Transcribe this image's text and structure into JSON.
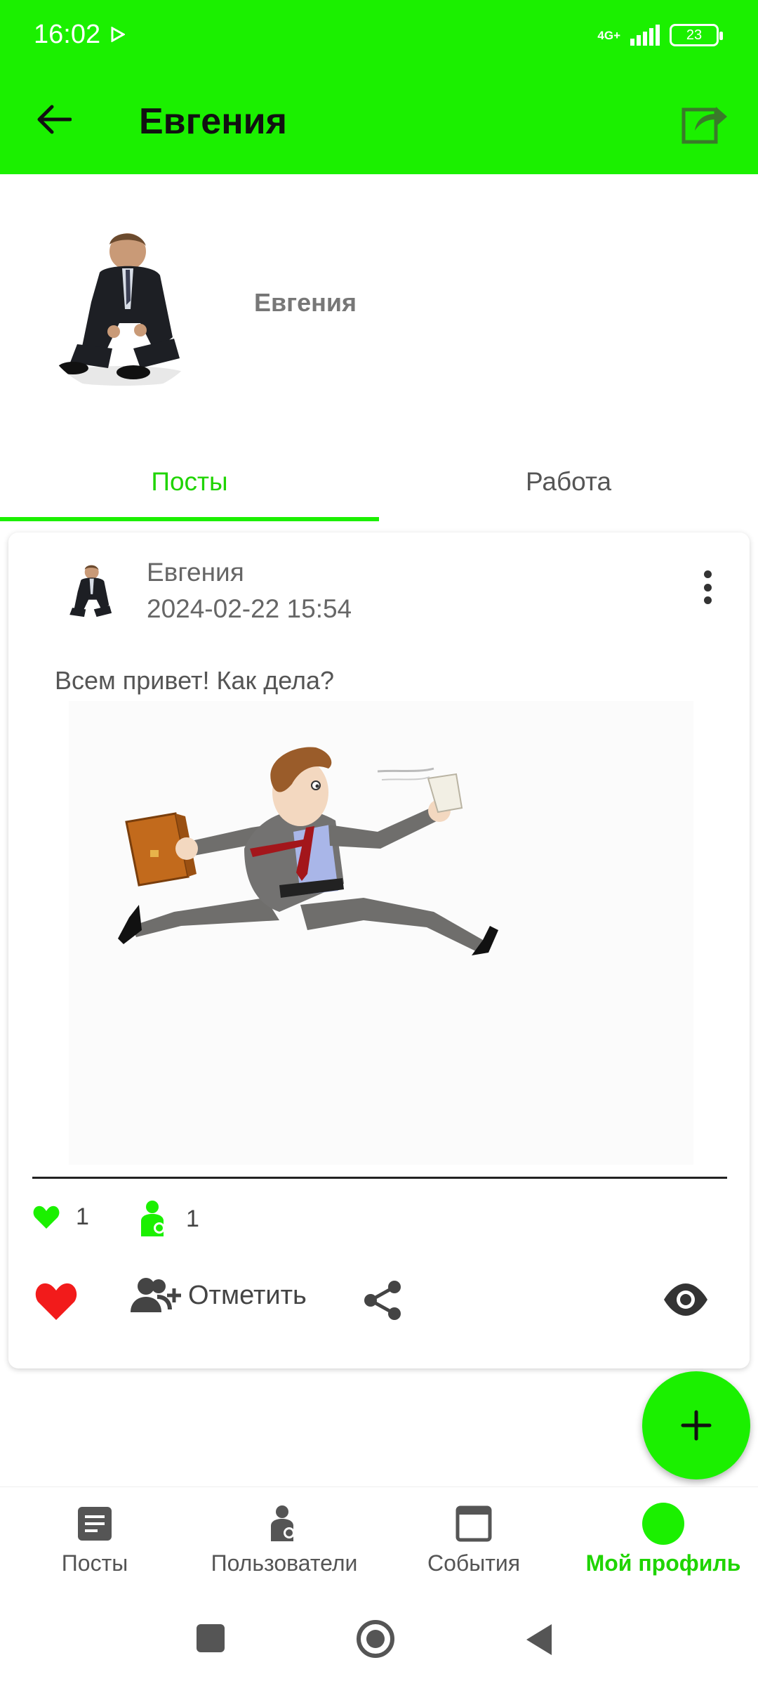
{
  "status_bar": {
    "time": "16:02",
    "network": "4G+",
    "battery": "23"
  },
  "app_bar": {
    "title": "Евгения",
    "back_icon": "arrow-left-icon",
    "share_icon": "share-box-icon"
  },
  "profile": {
    "name": "Евгения"
  },
  "tabs": [
    {
      "label": "Посты",
      "active": true
    },
    {
      "label": "Работа",
      "active": false
    }
  ],
  "post": {
    "author": "Евгения",
    "date": "2024-02-22 15:54",
    "text": "Всем привет! Как дела?",
    "likes": "1",
    "marks": "1",
    "mark_action_label": "Отметить"
  },
  "bottom_nav": [
    {
      "label": "Посты",
      "icon": "article-icon",
      "active": false
    },
    {
      "label": "Пользователи",
      "icon": "user-icon",
      "active": false
    },
    {
      "label": "События",
      "icon": "calendar-window-icon",
      "active": false
    },
    {
      "label": "Мой профиль",
      "icon": "profile-dot-icon",
      "active": true
    }
  ],
  "colors": {
    "accent": "#1bf000",
    "accent_text": "#1fd400",
    "like_red": "#f21b1b"
  }
}
